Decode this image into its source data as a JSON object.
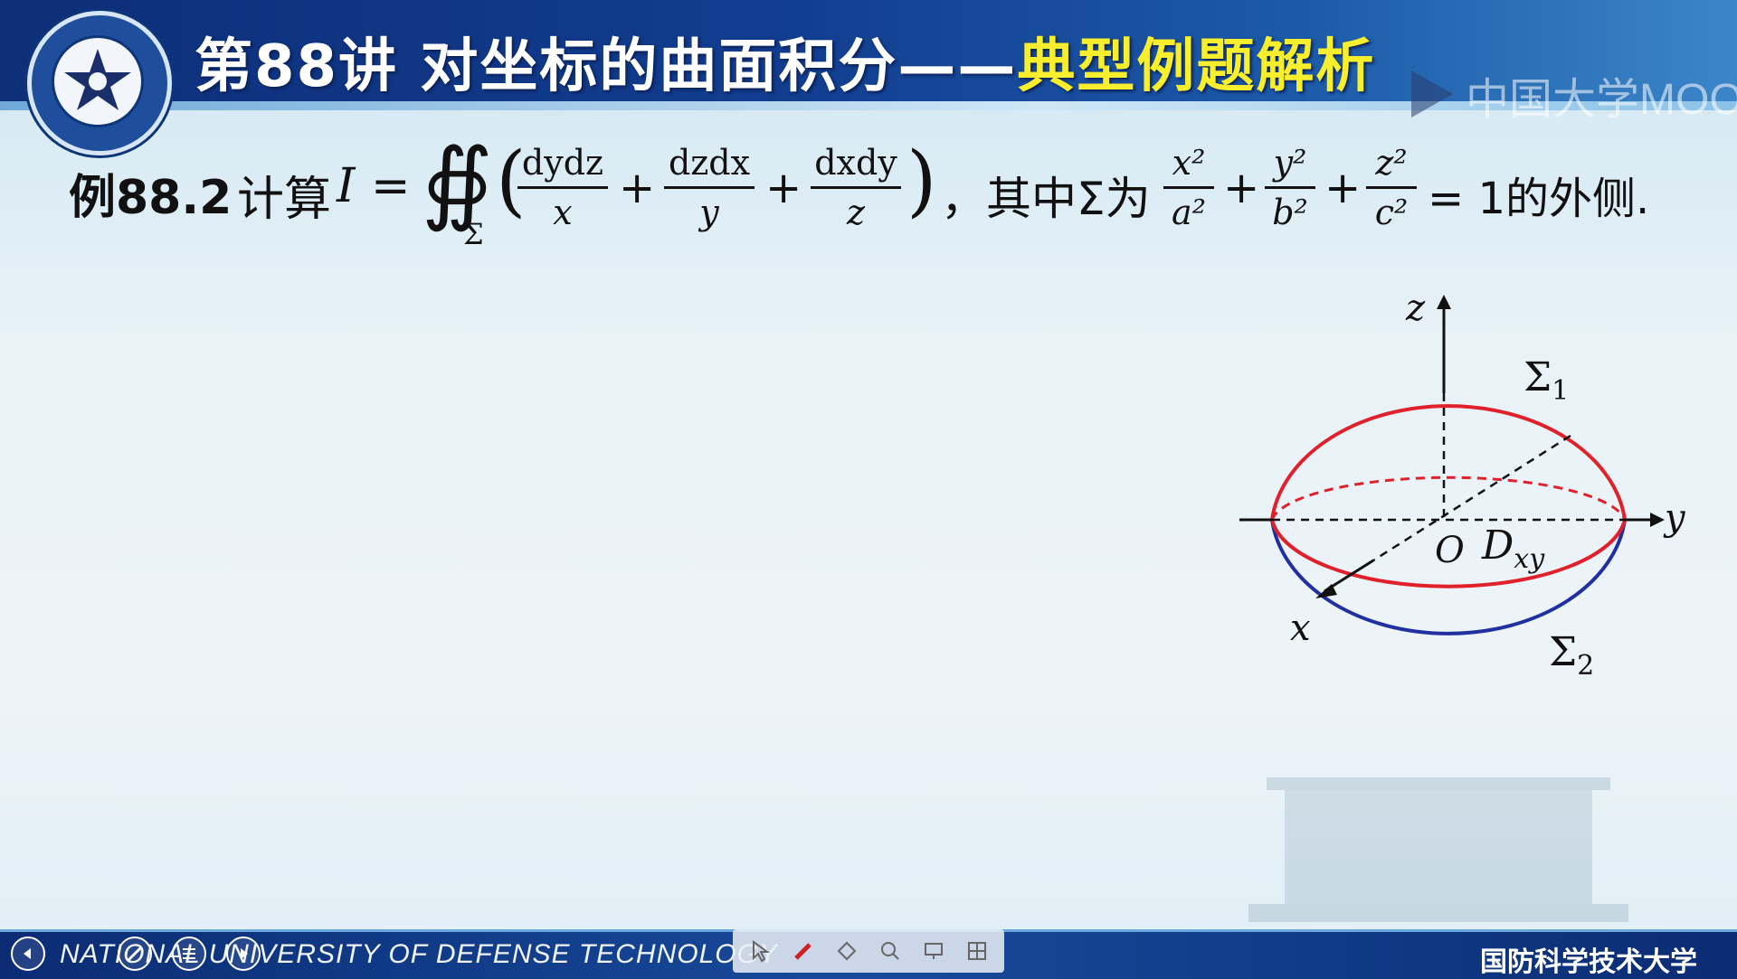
{
  "header": {
    "title": "第88讲  对坐标的曲面积分——",
    "title_accent": "典型例题解析",
    "watermark": "中国大学MOOC"
  },
  "problem": {
    "label": "例88.2",
    "compute": "计算",
    "I": "I",
    "eq": "=",
    "integral_sign": "∯",
    "sigma_sub": "Σ",
    "lparen": "(",
    "rparen": ")",
    "f1_num": "dydz",
    "f1_den": "x",
    "f2_num": "dzdx",
    "f2_den": "y",
    "f3_num": "dxdy",
    "f3_den": "z",
    "plus": "+",
    "where": "，其中Σ为",
    "e1_num": "x²",
    "e1_den": "a²",
    "e2_num": "y²",
    "e2_den": "b²",
    "e3_num": "z²",
    "e3_den": "c²",
    "eq_one": "= 1的外侧."
  },
  "diagram": {
    "z_label": "z",
    "y_label": "y",
    "x_label": "x",
    "origin": "O",
    "region": "D",
    "region_sub": "xy",
    "sigma1": "Σ",
    "sigma1_sub": "1",
    "sigma2": "Σ",
    "sigma2_sub": "2",
    "upper_color": "#e0202a",
    "lower_color": "#2030a0"
  },
  "footer": {
    "university_en": "NATIONAL UNIVERSITY OF DEFENSE TECHNOLOGY",
    "university_cn": "国防科学技术大学"
  },
  "toolbar": {
    "icons": [
      "pointer-icon",
      "pen-icon",
      "eraser-icon",
      "zoom-icon",
      "screen-icon",
      "grid-icon"
    ]
  }
}
